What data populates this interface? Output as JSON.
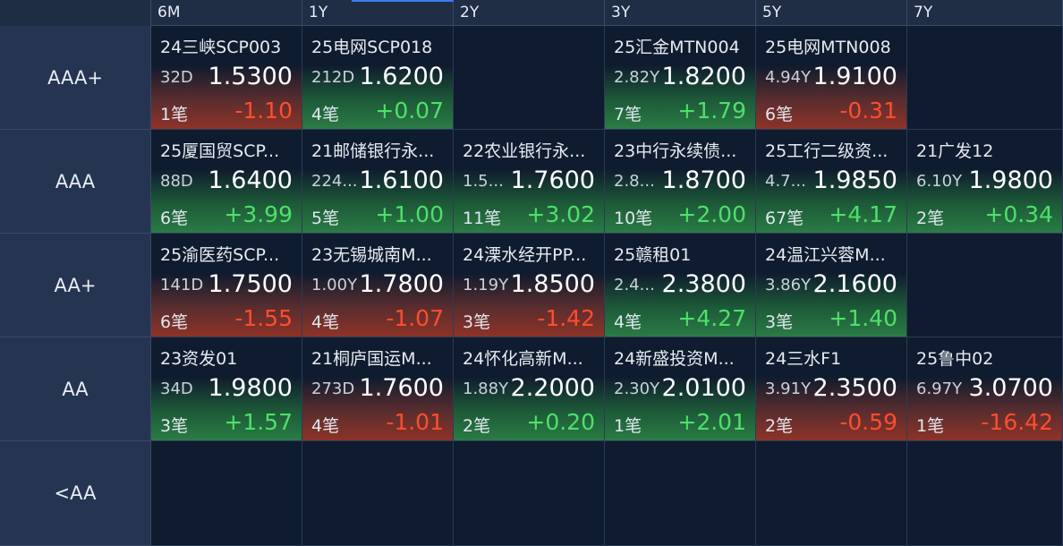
{
  "columns": [
    "6M",
    "1Y",
    "2Y",
    "3Y",
    "5Y",
    "7Y"
  ],
  "rows": [
    "AAA+",
    "AAA",
    "AA+",
    "AA",
    "<AA"
  ],
  "colors": {
    "up": "#4ee06a",
    "down": "#ff4d2e",
    "accent": "#3b7cf0"
  },
  "cells": [
    [
      {
        "name": "24三峡SCP003",
        "term": "32D",
        "yield": "1.5300",
        "count": "1笔",
        "change": "-1.10",
        "dir": "down"
      },
      {
        "name": "25电网SCP018",
        "term": "212D",
        "yield": "1.6200",
        "count": "4笔",
        "change": "+0.07",
        "dir": "up"
      },
      null,
      {
        "name": "25汇金MTN004",
        "term": "2.82Y",
        "yield": "1.8200",
        "count": "7笔",
        "change": "+1.79",
        "dir": "up"
      },
      {
        "name": "25电网MTN008",
        "term": "4.94Y",
        "yield": "1.9100",
        "count": "6笔",
        "change": "-0.31",
        "dir": "down"
      },
      null
    ],
    [
      {
        "name": "25厦国贸SCP...",
        "term": "88D",
        "yield": "1.6400",
        "count": "6笔",
        "change": "+3.99",
        "dir": "up"
      },
      {
        "name": "21邮储银行永...",
        "term": "224...",
        "yield": "1.6100",
        "count": "5笔",
        "change": "+1.00",
        "dir": "up"
      },
      {
        "name": "22农业银行永...",
        "term": "1.5...",
        "yield": "1.7600",
        "count": "11笔",
        "change": "+3.02",
        "dir": "up"
      },
      {
        "name": "23中行永续债...",
        "term": "2.8...",
        "yield": "1.8700",
        "count": "10笔",
        "change": "+2.00",
        "dir": "up"
      },
      {
        "name": "25工行二级资...",
        "term": "4.7...",
        "yield": "1.9850",
        "count": "67笔",
        "change": "+4.17",
        "dir": "up"
      },
      {
        "name": "21广发12",
        "term": "6.10Y",
        "yield": "1.9800",
        "count": "2笔",
        "change": "+0.34",
        "dir": "up"
      }
    ],
    [
      {
        "name": "25渝医药SCP...",
        "term": "141D",
        "yield": "1.7500",
        "count": "6笔",
        "change": "-1.55",
        "dir": "down"
      },
      {
        "name": "23无锡城南M...",
        "term": "1.00Y",
        "yield": "1.7800",
        "count": "4笔",
        "change": "-1.07",
        "dir": "down"
      },
      {
        "name": "24溧水经开PP...",
        "term": "1.19Y",
        "yield": "1.8500",
        "count": "3笔",
        "change": "-1.42",
        "dir": "down"
      },
      {
        "name": "25赣租01",
        "term": "2.4...",
        "yield": "2.3800",
        "count": "4笔",
        "change": "+4.27",
        "dir": "up"
      },
      {
        "name": "24温江兴蓉M...",
        "term": "3.86Y",
        "yield": "2.1600",
        "count": "3笔",
        "change": "+1.40",
        "dir": "up"
      },
      null
    ],
    [
      {
        "name": "23资发01",
        "term": "34D",
        "yield": "1.9800",
        "count": "3笔",
        "change": "+1.57",
        "dir": "up"
      },
      {
        "name": "21桐庐国运M...",
        "term": "273D",
        "yield": "1.7600",
        "count": "4笔",
        "change": "-1.01",
        "dir": "down"
      },
      {
        "name": "24怀化高新M...",
        "term": "1.88Y",
        "yield": "2.2000",
        "count": "2笔",
        "change": "+0.20",
        "dir": "up"
      },
      {
        "name": "24新盛投资M...",
        "term": "2.30Y",
        "yield": "2.0100",
        "count": "1笔",
        "change": "+2.01",
        "dir": "up"
      },
      {
        "name": "24三水F1",
        "term": "3.91Y",
        "yield": "2.3500",
        "count": "2笔",
        "change": "-0.59",
        "dir": "down"
      },
      {
        "name": "25鲁中02",
        "term": "6.97Y",
        "yield": "3.0700",
        "count": "1笔",
        "change": "-16.42",
        "dir": "down"
      }
    ],
    [
      null,
      null,
      null,
      null,
      null,
      null
    ]
  ]
}
